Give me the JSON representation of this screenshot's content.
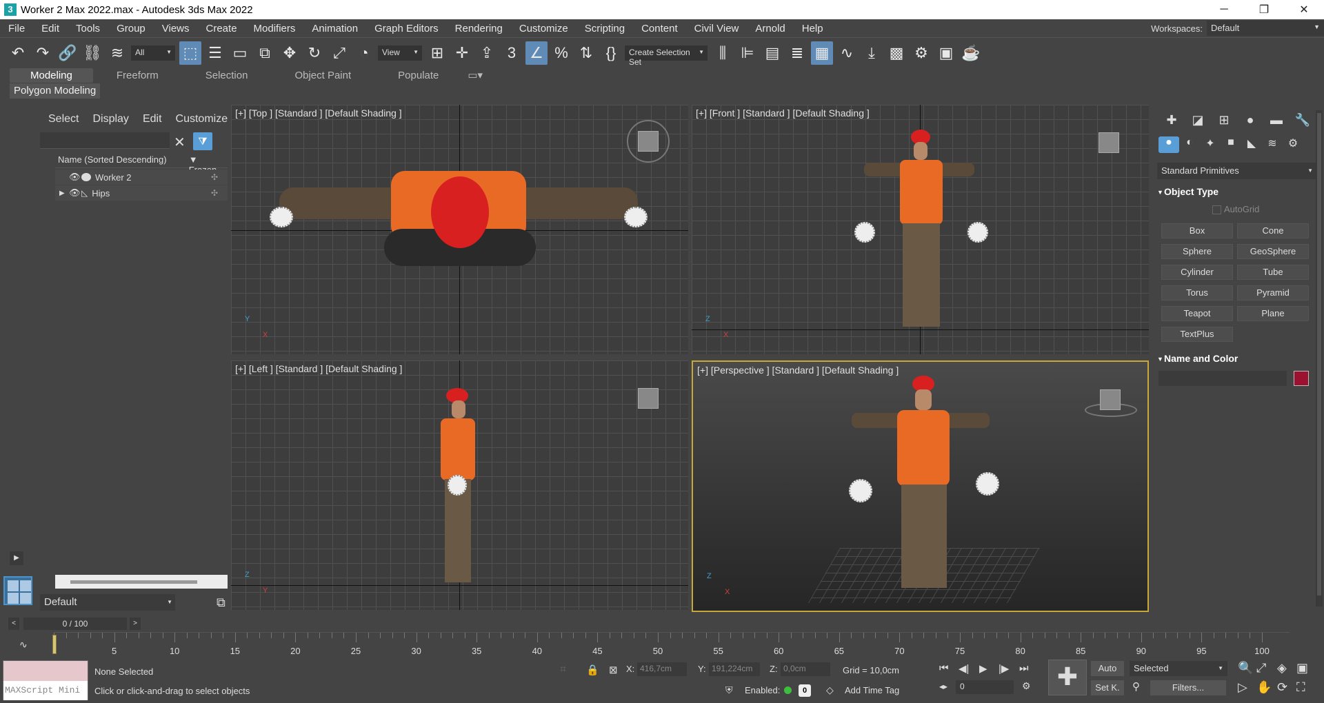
{
  "window": {
    "title": "Worker 2 Max 2022.max - Autodesk 3ds Max 2022",
    "app_icon": "3",
    "minimize": "─",
    "restore": "❐",
    "close": "✕"
  },
  "menu": [
    "File",
    "Edit",
    "Tools",
    "Group",
    "Views",
    "Create",
    "Modifiers",
    "Animation",
    "Graph Editors",
    "Rendering",
    "Customize",
    "Scripting",
    "Content",
    "Civil View",
    "Arnold",
    "Help"
  ],
  "workspaces": {
    "label": "Workspaces:",
    "value": "Default"
  },
  "toolbar": {
    "filter_value": "All",
    "refcoord_value": "View",
    "selection_set": "Create Selection Set"
  },
  "ribbon": {
    "tabs": [
      "Modeling",
      "Freeform",
      "Selection",
      "Object Paint",
      "Populate"
    ],
    "active_tab": "Modeling",
    "subpanel": "Polygon Modeling"
  },
  "scene_explorer": {
    "menu": [
      "Select",
      "Display",
      "Edit",
      "Customize"
    ],
    "column_name": "Name (Sorted Descending)",
    "column_frozen": "▼ Frozen",
    "rows": [
      {
        "name": "Worker 2"
      },
      {
        "name": "Hips"
      }
    ],
    "layer": "Default"
  },
  "viewports": {
    "top": "[+] [Top ] [Standard ] [Default Shading ]",
    "front": "[+] [Front ] [Standard ] [Default Shading ]",
    "left": "[+] [Left ] [Standard ] [Default Shading ]",
    "perspective": "[+] [Perspective ] [Standard ] [Default Shading ]"
  },
  "command_panel": {
    "category": "Standard Primitives",
    "object_type_title": "Object Type",
    "autogrid": "AutoGrid",
    "primitives": [
      "Box",
      "Cone",
      "Sphere",
      "GeoSphere",
      "Cylinder",
      "Tube",
      "Torus",
      "Pyramid",
      "Teapot",
      "Plane",
      "TextPlus"
    ],
    "name_color_title": "Name and Color",
    "color": "#9c1030"
  },
  "timeline": {
    "frame_display": "0 / 100",
    "ticks": [
      "5",
      "10",
      "15",
      "20",
      "25",
      "30",
      "35",
      "40",
      "45",
      "50",
      "55",
      "60",
      "65",
      "70",
      "75",
      "80",
      "85",
      "90",
      "95",
      "100"
    ]
  },
  "status": {
    "maxscript": "MAXScript Mini",
    "selection": "None Selected",
    "prompt": "Click or click-and-drag to select objects",
    "x_label": "X:",
    "x_value": "416,7cm",
    "y_label": "Y:",
    "y_value": "191,224cm",
    "z_label": "Z:",
    "z_value": "0,0cm",
    "grid": "Grid = 10,0cm",
    "enabled": "Enabled:",
    "time_tag": "Add Time Tag",
    "zero": "0",
    "auto": "Auto",
    "selected": "Selected",
    "setkey": "Set K.",
    "filters": "Filters...",
    "frame": "0"
  }
}
